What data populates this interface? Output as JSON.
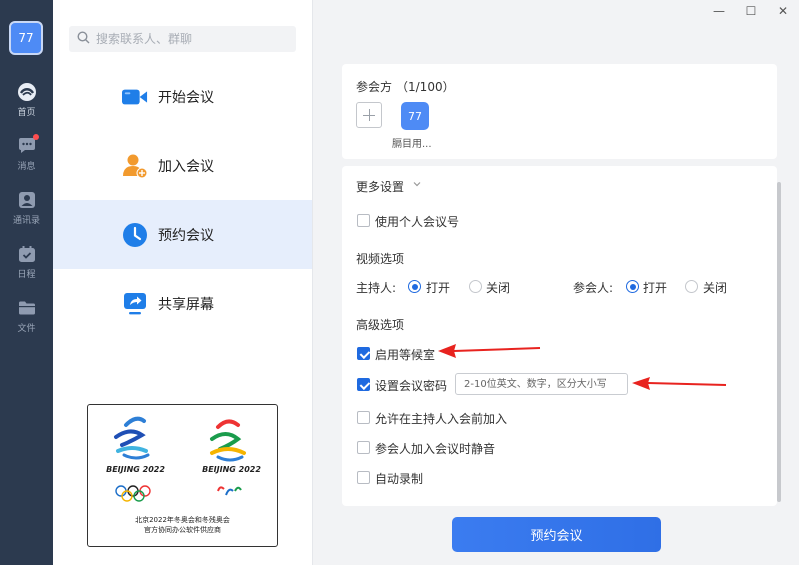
{
  "rail": {
    "avatar_text": "77",
    "items": [
      {
        "label": "首页",
        "icon": "home-icon"
      },
      {
        "label": "消息",
        "icon": "chat-icon"
      },
      {
        "label": "通讯录",
        "icon": "contacts-icon"
      },
      {
        "label": "日程",
        "icon": "calendar-icon"
      },
      {
        "label": "文件",
        "icon": "folder-icon"
      }
    ]
  },
  "search": {
    "placeholder": "搜索联系人、群聊"
  },
  "menu": {
    "items": [
      {
        "label": "开始会议",
        "icon": "video-camera-icon"
      },
      {
        "label": "加入会议",
        "icon": "add-person-icon"
      },
      {
        "label": "预约会议",
        "icon": "clock-icon"
      },
      {
        "label": "共享屏幕",
        "icon": "share-screen-icon"
      }
    ],
    "active": "预约会议"
  },
  "logo": {
    "beijing_left": "BEIJING 2022",
    "beijing_right": "BEIJING 2022",
    "caption_line1": "北京2022年冬奥会和冬残奥会",
    "caption_line2": "官方协同办公软件供应商"
  },
  "window_controls": {
    "minimize": "—",
    "maximize": "☐",
    "close": "✕"
  },
  "participants": {
    "title": "参会方",
    "count": "（1/100）",
    "avatar_text": "77",
    "name": "膈目用..."
  },
  "settings": {
    "more_label": "更多设置",
    "personal_id_label": "使用个人会议号",
    "personal_id_checked": false,
    "video_section": "视频选项",
    "host_label": "主持人:",
    "participant_label": "参会人:",
    "on_label": "打开",
    "off_label": "关闭",
    "host_video": "打开",
    "participant_video": "打开",
    "advanced_section": "高级选项",
    "waiting_room_label": "启用等候室",
    "waiting_room_checked": true,
    "password_label": "设置会议密码",
    "password_checked": true,
    "password_placeholder": "2-10位英文、数字，区分大小写",
    "join_before_host_label": "允许在主持人入会前加入",
    "join_before_host_checked": false,
    "mute_on_join_label": "参会人加入会议时静音",
    "mute_on_join_checked": false,
    "auto_record_label": "自动录制",
    "auto_record_checked": false
  },
  "submit_label": "预约会议",
  "colors": {
    "rail": "#2c3a4f",
    "accent": "#1f6ae0",
    "active_bg": "#e6eefc",
    "annotation": "#e8231f"
  }
}
